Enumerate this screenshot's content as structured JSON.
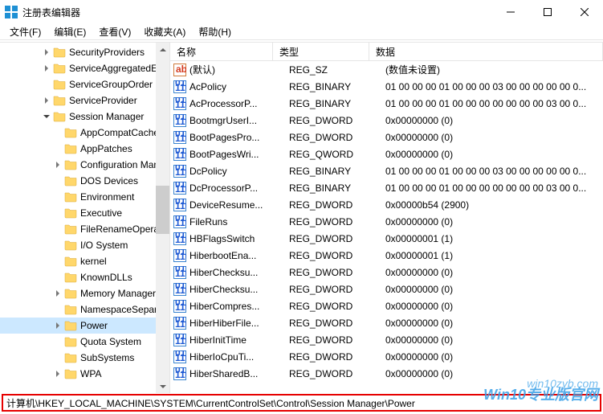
{
  "window": {
    "title": "注册表编辑器"
  },
  "menu": {
    "file": "文件(F)",
    "edit": "编辑(E)",
    "view": "查看(V)",
    "favorites": "收藏夹(A)",
    "help": "帮助(H)"
  },
  "tree": {
    "items": [
      {
        "label": "SecurityProviders",
        "depth": 3,
        "expand": "closed"
      },
      {
        "label": "ServiceAggregatedEv",
        "depth": 3,
        "expand": "closed"
      },
      {
        "label": "ServiceGroupOrder",
        "depth": 3,
        "expand": "none"
      },
      {
        "label": "ServiceProvider",
        "depth": 3,
        "expand": "closed"
      },
      {
        "label": "Session Manager",
        "depth": 3,
        "expand": "open"
      },
      {
        "label": "AppCompatCache",
        "depth": 4,
        "expand": "none"
      },
      {
        "label": "AppPatches",
        "depth": 4,
        "expand": "none"
      },
      {
        "label": "Configuration Man",
        "depth": 4,
        "expand": "closed"
      },
      {
        "label": "DOS Devices",
        "depth": 4,
        "expand": "none"
      },
      {
        "label": "Environment",
        "depth": 4,
        "expand": "none"
      },
      {
        "label": "Executive",
        "depth": 4,
        "expand": "none"
      },
      {
        "label": "FileRenameOperat",
        "depth": 4,
        "expand": "none"
      },
      {
        "label": "I/O System",
        "depth": 4,
        "expand": "none"
      },
      {
        "label": "kernel",
        "depth": 4,
        "expand": "none"
      },
      {
        "label": "KnownDLLs",
        "depth": 4,
        "expand": "none"
      },
      {
        "label": "Memory Manager",
        "depth": 4,
        "expand": "closed"
      },
      {
        "label": "NamespaceSepara",
        "depth": 4,
        "expand": "none"
      },
      {
        "label": "Power",
        "depth": 4,
        "expand": "closed",
        "selected": true
      },
      {
        "label": "Quota System",
        "depth": 4,
        "expand": "none"
      },
      {
        "label": "SubSystems",
        "depth": 4,
        "expand": "none"
      },
      {
        "label": "WPA",
        "depth": 4,
        "expand": "closed"
      }
    ]
  },
  "list": {
    "headers": {
      "name": "名称",
      "type": "类型",
      "data": "数据"
    },
    "rows": [
      {
        "icon": "sz",
        "name": "(默认)",
        "type": "REG_SZ",
        "data": "(数值未设置)"
      },
      {
        "icon": "bin",
        "name": "AcPolicy",
        "type": "REG_BINARY",
        "data": "01 00 00 00 01 00 00 00 03 00 00 00 00 00 0..."
      },
      {
        "icon": "bin",
        "name": "AcProcessorP...",
        "type": "REG_BINARY",
        "data": "01 00 00 00 01 00 00 00 00 00 00 00 03 00 0..."
      },
      {
        "icon": "bin",
        "name": "BootmgrUserI...",
        "type": "REG_DWORD",
        "data": "0x00000000 (0)"
      },
      {
        "icon": "bin",
        "name": "BootPagesPro...",
        "type": "REG_DWORD",
        "data": "0x00000000 (0)"
      },
      {
        "icon": "bin",
        "name": "BootPagesWri...",
        "type": "REG_QWORD",
        "data": "0x00000000 (0)"
      },
      {
        "icon": "bin",
        "name": "DcPolicy",
        "type": "REG_BINARY",
        "data": "01 00 00 00 01 00 00 00 03 00 00 00 00 00 0..."
      },
      {
        "icon": "bin",
        "name": "DcProcessorP...",
        "type": "REG_BINARY",
        "data": "01 00 00 00 01 00 00 00 00 00 00 00 03 00 0..."
      },
      {
        "icon": "bin",
        "name": "DeviceResume...",
        "type": "REG_DWORD",
        "data": "0x00000b54 (2900)"
      },
      {
        "icon": "bin",
        "name": "FileRuns",
        "type": "REG_DWORD",
        "data": "0x00000000 (0)"
      },
      {
        "icon": "bin",
        "name": "HBFlagsSwitch",
        "type": "REG_DWORD",
        "data": "0x00000001 (1)"
      },
      {
        "icon": "bin",
        "name": "HiberbootEna...",
        "type": "REG_DWORD",
        "data": "0x00000001 (1)"
      },
      {
        "icon": "bin",
        "name": "HiberChecksu...",
        "type": "REG_DWORD",
        "data": "0x00000000 (0)"
      },
      {
        "icon": "bin",
        "name": "HiberChecksu...",
        "type": "REG_DWORD",
        "data": "0x00000000 (0)"
      },
      {
        "icon": "bin",
        "name": "HiberCompres...",
        "type": "REG_DWORD",
        "data": "0x00000000 (0)"
      },
      {
        "icon": "bin",
        "name": "HiberHiberFile...",
        "type": "REG_DWORD",
        "data": "0x00000000 (0)"
      },
      {
        "icon": "bin",
        "name": "HiberInitTime",
        "type": "REG_DWORD",
        "data": "0x00000000 (0)"
      },
      {
        "icon": "bin",
        "name": "HiberIoCpuTi...",
        "type": "REG_DWORD",
        "data": "0x00000000 (0)"
      },
      {
        "icon": "bin",
        "name": "HiberSharedB...",
        "type": "REG_DWORD",
        "data": "0x00000000 (0)"
      }
    ]
  },
  "statusbar": {
    "path": "计算机\\HKEY_LOCAL_MACHINE\\SYSTEM\\CurrentControlSet\\Control\\Session Manager\\Power"
  },
  "watermark": {
    "line1": "win10zyb.com",
    "line2": "Win10专业版官网"
  }
}
